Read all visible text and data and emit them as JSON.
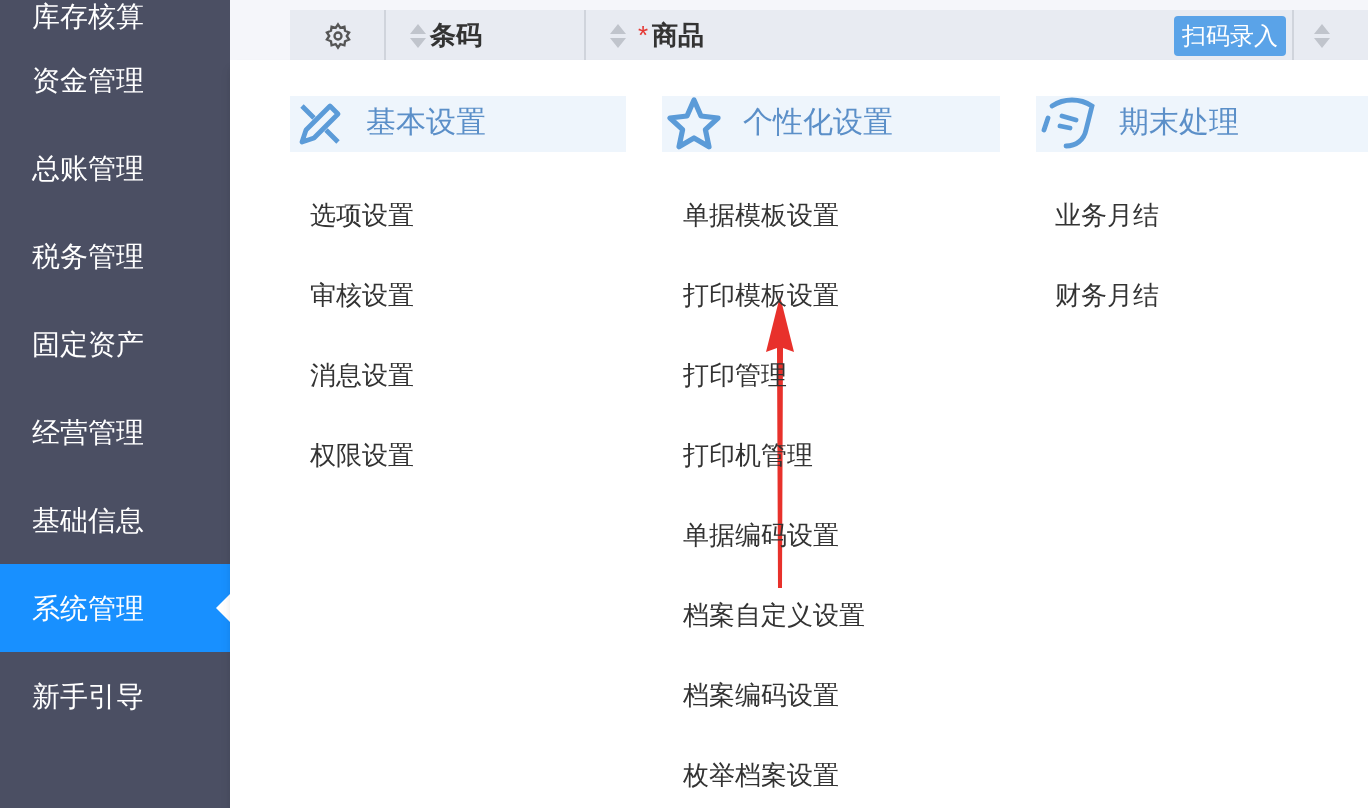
{
  "sidebar": {
    "items": [
      {
        "label": "库存核算",
        "selected": false
      },
      {
        "label": "资金管理",
        "selected": false
      },
      {
        "label": "总账管理",
        "selected": false
      },
      {
        "label": "税务管理",
        "selected": false
      },
      {
        "label": "固定资产",
        "selected": false
      },
      {
        "label": "经营管理",
        "selected": false
      },
      {
        "label": "基础信息",
        "selected": false
      },
      {
        "label": "系统管理",
        "selected": true
      },
      {
        "label": "新手引导",
        "selected": false
      }
    ]
  },
  "table": {
    "columns": [
      {
        "kind": "settings"
      },
      {
        "kind": "sort",
        "label": "条码",
        "required": false
      },
      {
        "kind": "sort",
        "label": "商品",
        "required": true,
        "required_mark": "*",
        "badge": "扫码录入"
      },
      {
        "kind": "sort-cut"
      }
    ]
  },
  "menu": {
    "sections": [
      {
        "kind": "pencil",
        "title": "基本设置",
        "items": [
          "选项设置",
          "审核设置",
          "消息设置",
          "权限设置"
        ]
      },
      {
        "kind": "star",
        "title": "个性化设置",
        "items": [
          "单据模板设置",
          "打印模板设置",
          "打印管理",
          "打印机管理",
          "单据编码设置",
          "档案自定义设置",
          "档案编码设置",
          "枚举档案设置"
        ]
      },
      {
        "kind": "document",
        "title": "期末处理",
        "items": [
          "业务月结",
          "财务月结"
        ]
      }
    ]
  },
  "annotation": {
    "kind": "arrow"
  }
}
